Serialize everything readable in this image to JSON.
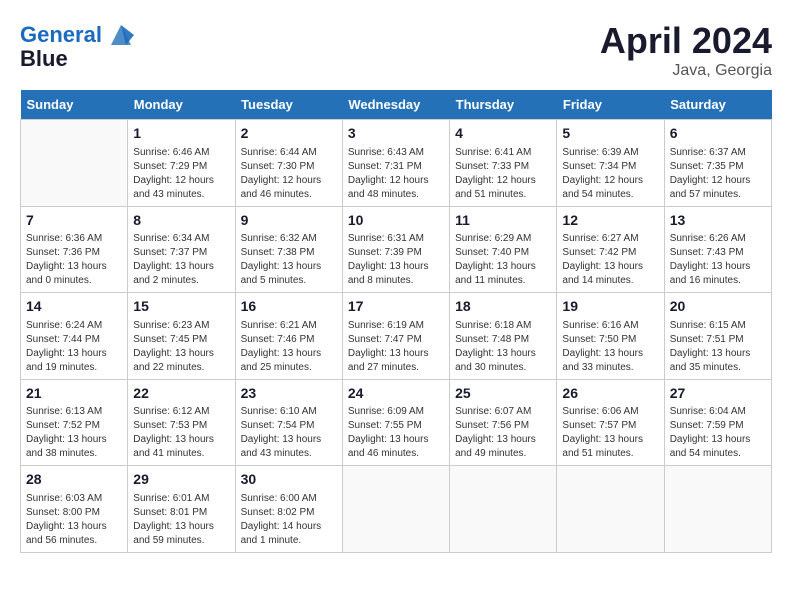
{
  "header": {
    "logo_line1": "General",
    "logo_line2": "Blue",
    "month": "April 2024",
    "location": "Java, Georgia"
  },
  "weekdays": [
    "Sunday",
    "Monday",
    "Tuesday",
    "Wednesday",
    "Thursday",
    "Friday",
    "Saturday"
  ],
  "weeks": [
    [
      {
        "day": "",
        "info": ""
      },
      {
        "day": "1",
        "info": "Sunrise: 6:46 AM\nSunset: 7:29 PM\nDaylight: 12 hours\nand 43 minutes."
      },
      {
        "day": "2",
        "info": "Sunrise: 6:44 AM\nSunset: 7:30 PM\nDaylight: 12 hours\nand 46 minutes."
      },
      {
        "day": "3",
        "info": "Sunrise: 6:43 AM\nSunset: 7:31 PM\nDaylight: 12 hours\nand 48 minutes."
      },
      {
        "day": "4",
        "info": "Sunrise: 6:41 AM\nSunset: 7:33 PM\nDaylight: 12 hours\nand 51 minutes."
      },
      {
        "day": "5",
        "info": "Sunrise: 6:39 AM\nSunset: 7:34 PM\nDaylight: 12 hours\nand 54 minutes."
      },
      {
        "day": "6",
        "info": "Sunrise: 6:37 AM\nSunset: 7:35 PM\nDaylight: 12 hours\nand 57 minutes."
      }
    ],
    [
      {
        "day": "7",
        "info": "Sunrise: 6:36 AM\nSunset: 7:36 PM\nDaylight: 13 hours\nand 0 minutes."
      },
      {
        "day": "8",
        "info": "Sunrise: 6:34 AM\nSunset: 7:37 PM\nDaylight: 13 hours\nand 2 minutes."
      },
      {
        "day": "9",
        "info": "Sunrise: 6:32 AM\nSunset: 7:38 PM\nDaylight: 13 hours\nand 5 minutes."
      },
      {
        "day": "10",
        "info": "Sunrise: 6:31 AM\nSunset: 7:39 PM\nDaylight: 13 hours\nand 8 minutes."
      },
      {
        "day": "11",
        "info": "Sunrise: 6:29 AM\nSunset: 7:40 PM\nDaylight: 13 hours\nand 11 minutes."
      },
      {
        "day": "12",
        "info": "Sunrise: 6:27 AM\nSunset: 7:42 PM\nDaylight: 13 hours\nand 14 minutes."
      },
      {
        "day": "13",
        "info": "Sunrise: 6:26 AM\nSunset: 7:43 PM\nDaylight: 13 hours\nand 16 minutes."
      }
    ],
    [
      {
        "day": "14",
        "info": "Sunrise: 6:24 AM\nSunset: 7:44 PM\nDaylight: 13 hours\nand 19 minutes."
      },
      {
        "day": "15",
        "info": "Sunrise: 6:23 AM\nSunset: 7:45 PM\nDaylight: 13 hours\nand 22 minutes."
      },
      {
        "day": "16",
        "info": "Sunrise: 6:21 AM\nSunset: 7:46 PM\nDaylight: 13 hours\nand 25 minutes."
      },
      {
        "day": "17",
        "info": "Sunrise: 6:19 AM\nSunset: 7:47 PM\nDaylight: 13 hours\nand 27 minutes."
      },
      {
        "day": "18",
        "info": "Sunrise: 6:18 AM\nSunset: 7:48 PM\nDaylight: 13 hours\nand 30 minutes."
      },
      {
        "day": "19",
        "info": "Sunrise: 6:16 AM\nSunset: 7:50 PM\nDaylight: 13 hours\nand 33 minutes."
      },
      {
        "day": "20",
        "info": "Sunrise: 6:15 AM\nSunset: 7:51 PM\nDaylight: 13 hours\nand 35 minutes."
      }
    ],
    [
      {
        "day": "21",
        "info": "Sunrise: 6:13 AM\nSunset: 7:52 PM\nDaylight: 13 hours\nand 38 minutes."
      },
      {
        "day": "22",
        "info": "Sunrise: 6:12 AM\nSunset: 7:53 PM\nDaylight: 13 hours\nand 41 minutes."
      },
      {
        "day": "23",
        "info": "Sunrise: 6:10 AM\nSunset: 7:54 PM\nDaylight: 13 hours\nand 43 minutes."
      },
      {
        "day": "24",
        "info": "Sunrise: 6:09 AM\nSunset: 7:55 PM\nDaylight: 13 hours\nand 46 minutes."
      },
      {
        "day": "25",
        "info": "Sunrise: 6:07 AM\nSunset: 7:56 PM\nDaylight: 13 hours\nand 49 minutes."
      },
      {
        "day": "26",
        "info": "Sunrise: 6:06 AM\nSunset: 7:57 PM\nDaylight: 13 hours\nand 51 minutes."
      },
      {
        "day": "27",
        "info": "Sunrise: 6:04 AM\nSunset: 7:59 PM\nDaylight: 13 hours\nand 54 minutes."
      }
    ],
    [
      {
        "day": "28",
        "info": "Sunrise: 6:03 AM\nSunset: 8:00 PM\nDaylight: 13 hours\nand 56 minutes."
      },
      {
        "day": "29",
        "info": "Sunrise: 6:01 AM\nSunset: 8:01 PM\nDaylight: 13 hours\nand 59 minutes."
      },
      {
        "day": "30",
        "info": "Sunrise: 6:00 AM\nSunset: 8:02 PM\nDaylight: 14 hours\nand 1 minute."
      },
      {
        "day": "",
        "info": ""
      },
      {
        "day": "",
        "info": ""
      },
      {
        "day": "",
        "info": ""
      },
      {
        "day": "",
        "info": ""
      }
    ]
  ]
}
